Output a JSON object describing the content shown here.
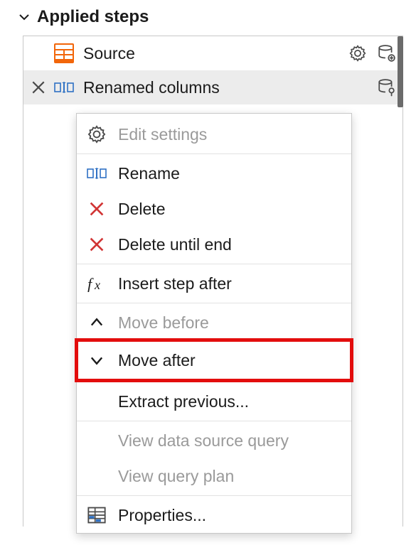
{
  "section": {
    "title": "Applied steps"
  },
  "steps": {
    "source": {
      "label": "Source"
    },
    "renamed": {
      "label": "Renamed columns"
    }
  },
  "menu": {
    "edit_settings": "Edit settings",
    "rename": "Rename",
    "delete": "Delete",
    "delete_until_end": "Delete until end",
    "insert_step": "Insert step after",
    "move_before": "Move before",
    "move_after": "Move after",
    "extract_prev": "Extract previous...",
    "view_dsq": "View data source query",
    "view_plan": "View query plan",
    "properties": "Properties..."
  }
}
